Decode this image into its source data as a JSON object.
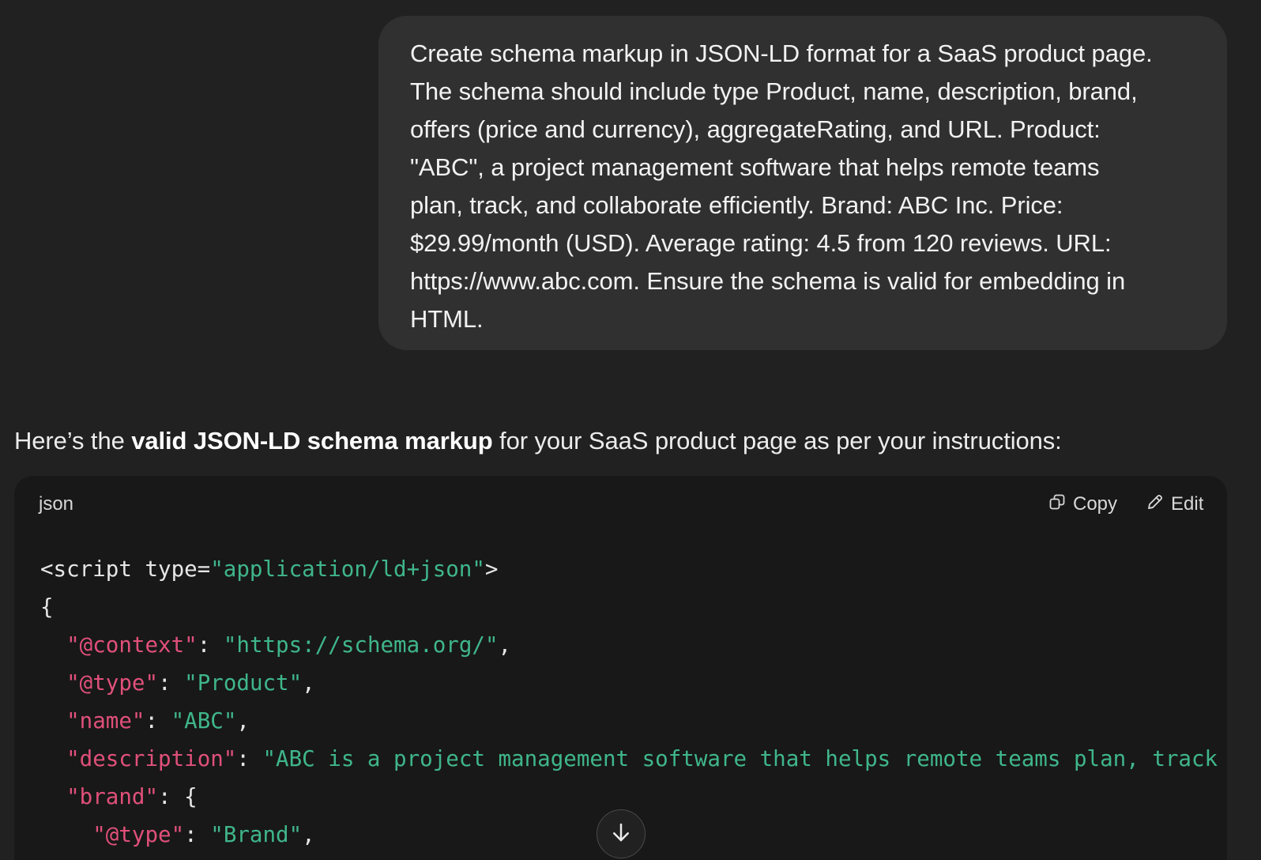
{
  "user_message": {
    "lines": [
      "Create schema markup in JSON-LD format for a SaaS product page.",
      "The schema should include type Product, name, description, brand,",
      "offers (price and currency), aggregateRating, and URL. Product:",
      "\"ABC\", a project management software that helps remote teams",
      "plan, track, and collaborate efficiently. Brand: ABC Inc. Price:",
      "$29.99/month (USD). Average rating: 4.5 from 120 reviews. URL:",
      "https://www.abc.com. Ensure the schema is valid for embedding in",
      "HTML."
    ]
  },
  "assistant": {
    "intro_before": "Here’s the ",
    "intro_bold": "valid JSON-LD schema markup",
    "intro_after": " for your SaaS product page as per your instructions:"
  },
  "code_block": {
    "language": "json",
    "copy_label": "Copy",
    "edit_label": "Edit",
    "copy_icon": "copy-icon",
    "edit_icon": "pencil-icon",
    "lines": [
      [
        {
          "t": "<script type=",
          "c": "plain"
        },
        {
          "t": "\"application/ld+json\"",
          "c": "str"
        },
        {
          "t": ">",
          "c": "plain"
        }
      ],
      [
        {
          "t": "{",
          "c": "plain"
        }
      ],
      [
        {
          "t": "  ",
          "c": "plain"
        },
        {
          "t": "\"@context\"",
          "c": "key"
        },
        {
          "t": ": ",
          "c": "plain"
        },
        {
          "t": "\"https://schema.org/\"",
          "c": "str"
        },
        {
          "t": ",",
          "c": "plain"
        }
      ],
      [
        {
          "t": "  ",
          "c": "plain"
        },
        {
          "t": "\"@type\"",
          "c": "key"
        },
        {
          "t": ": ",
          "c": "plain"
        },
        {
          "t": "\"Product\"",
          "c": "str"
        },
        {
          "t": ",",
          "c": "plain"
        }
      ],
      [
        {
          "t": "  ",
          "c": "plain"
        },
        {
          "t": "\"name\"",
          "c": "key"
        },
        {
          "t": ": ",
          "c": "plain"
        },
        {
          "t": "\"ABC\"",
          "c": "str"
        },
        {
          "t": ",",
          "c": "plain"
        }
      ],
      [
        {
          "t": "  ",
          "c": "plain"
        },
        {
          "t": "\"description\"",
          "c": "key"
        },
        {
          "t": ": ",
          "c": "plain"
        },
        {
          "t": "\"ABC is a project management software that helps remote teams plan, track",
          "c": "str"
        }
      ],
      [
        {
          "t": "  ",
          "c": "plain"
        },
        {
          "t": "\"brand\"",
          "c": "key"
        },
        {
          "t": ": {",
          "c": "plain"
        }
      ],
      [
        {
          "t": "    ",
          "c": "plain"
        },
        {
          "t": "\"@type\"",
          "c": "key"
        },
        {
          "t": ": ",
          "c": "plain"
        },
        {
          "t": "\"Brand\"",
          "c": "str"
        },
        {
          "t": ",",
          "c": "plain"
        }
      ]
    ]
  },
  "scroll_button": {
    "icon": "arrow-down-icon"
  },
  "colors": {
    "background": "#212121",
    "bubble": "#303030",
    "code_bg": "#181818",
    "string": "#3fb68b",
    "key": "#e0507a"
  }
}
